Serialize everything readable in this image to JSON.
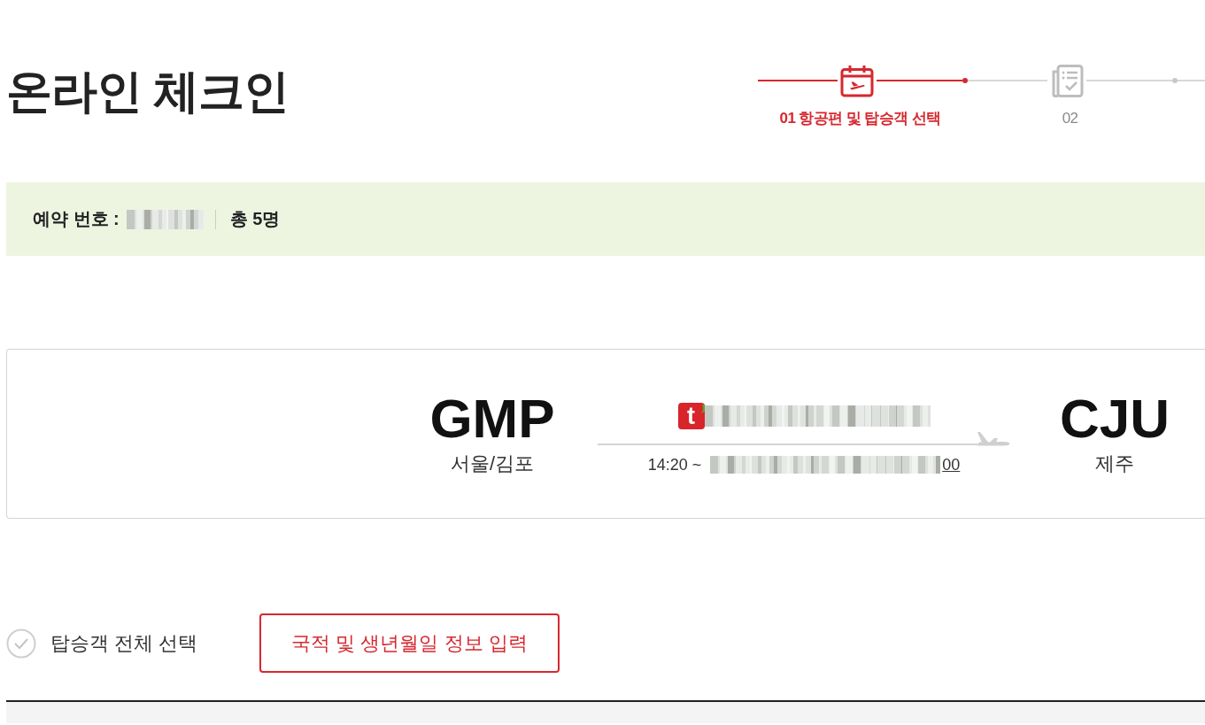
{
  "page": {
    "title": "온라인 체크인"
  },
  "steps": [
    {
      "kind": "calendar",
      "label": "01 항공편 및 탑승객 선택",
      "selected": true
    },
    {
      "kind": "checklist",
      "label": "02",
      "selected": false
    }
  ],
  "reservation": {
    "label": "예약 번호 :",
    "total": "총 5명"
  },
  "flight": {
    "origin": {
      "code": "GMP",
      "city": "서울/김포"
    },
    "airline_logo": "t",
    "departure": "14:20 ~",
    "link_tail": "00",
    "destination": {
      "code": "CJU",
      "city": "제주"
    }
  },
  "select_all": {
    "label": "탑승객 전체 선택",
    "checked": false
  },
  "actions": [
    {
      "label": "국적 및 생년월일 정보 입력"
    }
  ]
}
